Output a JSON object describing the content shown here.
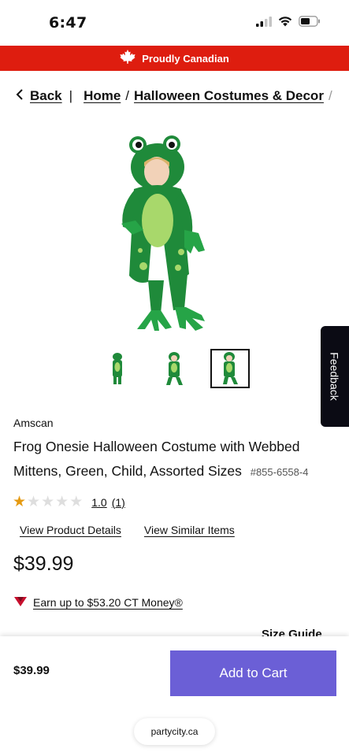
{
  "status_bar": {
    "time": "6:47",
    "icons": [
      "cellular-signal-icon",
      "wifi-icon",
      "battery-icon"
    ]
  },
  "banner": {
    "text": "Proudly Canadian",
    "icon": "maple-leaf-icon",
    "color": "#de1d0f"
  },
  "breadcrumb": {
    "back_label": "Back",
    "divider": "|",
    "items": [
      "Home",
      "Halloween Costumes & Decor"
    ],
    "separator": "/"
  },
  "product": {
    "brand": "Amscan",
    "title": "Frog Onesie Halloween Costume with Webbed Mittens, Green, Child, Assorted Sizes",
    "sku": "#855-6558-4",
    "rating_value": "1.0",
    "rating_count": "(1)",
    "stars_filled": 1,
    "stars_total": 5,
    "price": "$39.99",
    "thumbnail_count": 3,
    "selected_thumbnail": 3
  },
  "links": {
    "details": "View Product Details",
    "similar": "View Similar Items"
  },
  "ct_money": {
    "text": "Earn up to $53.20 CT Money®"
  },
  "size_guide": "Size Guide",
  "feedback": "Feedback",
  "bottom_bar": {
    "price": "$39.99",
    "add_to_cart": "Add to Cart",
    "button_color": "#6b5fd6",
    "url": "partycity.ca"
  }
}
